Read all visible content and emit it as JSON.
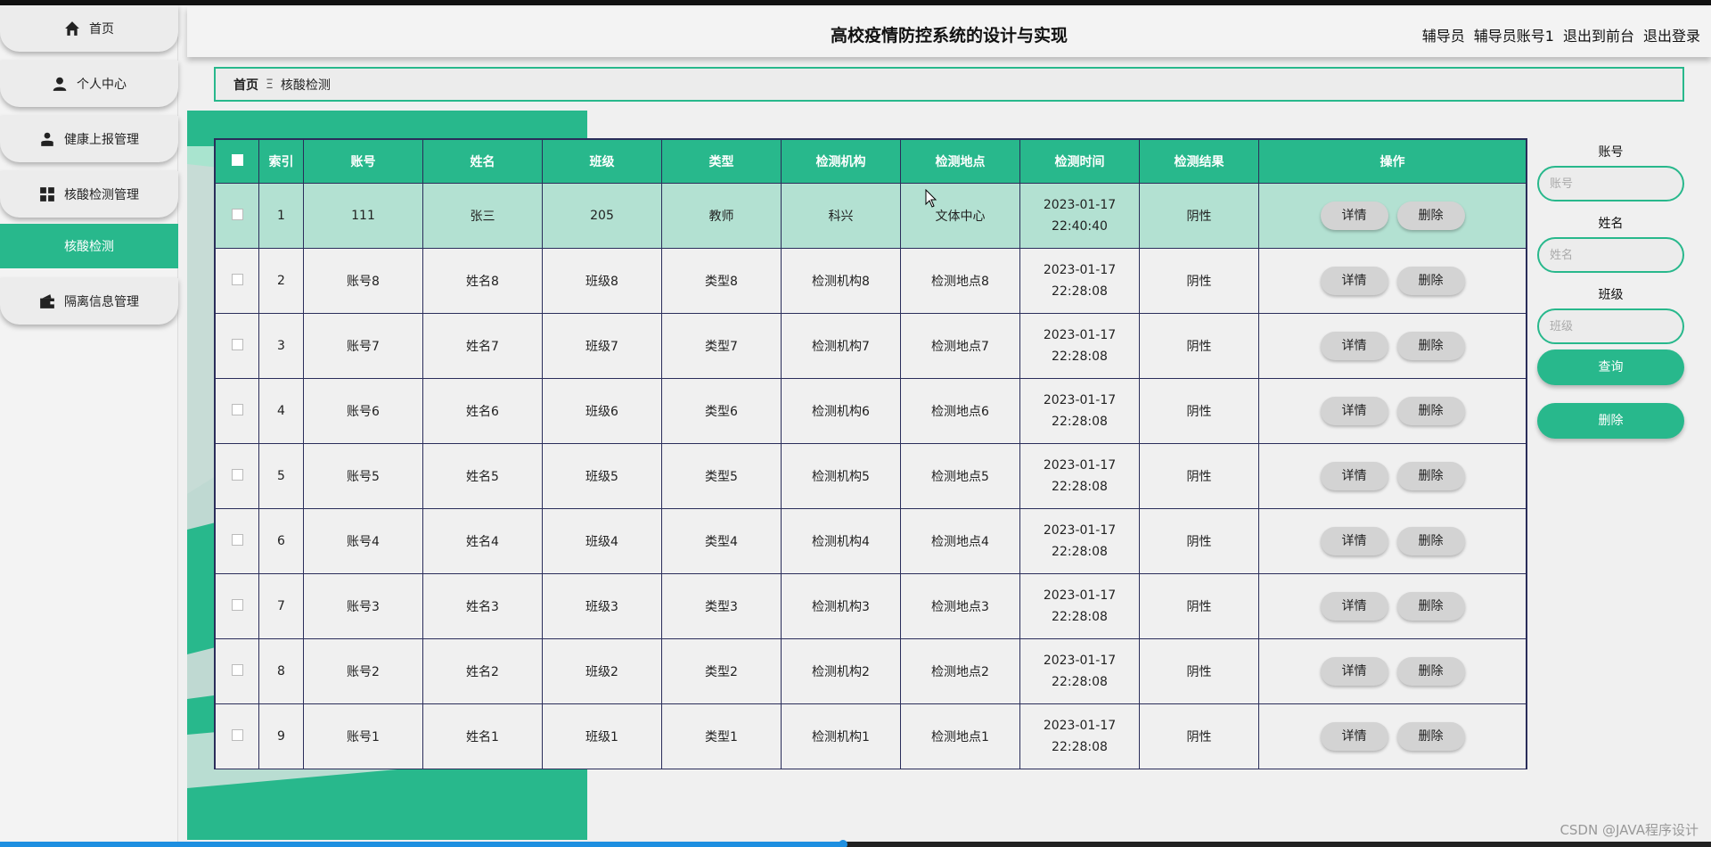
{
  "app": {
    "title": "高校疫情防控系统的设计与实现"
  },
  "header": {
    "role": "辅导员",
    "account": "辅导员账号1",
    "to_front": "退出到前台",
    "logout": "退出登录"
  },
  "sidebar": {
    "items": [
      {
        "label": "首页",
        "icon": "home-icon"
      },
      {
        "label": "个人中心",
        "icon": "person-icon"
      },
      {
        "label": "健康上报管理",
        "icon": "user-report-icon"
      },
      {
        "label": "核酸检测管理",
        "icon": "grid-icon"
      },
      {
        "label": "核酸检测",
        "icon": "",
        "active": true
      },
      {
        "label": "隔离信息管理",
        "icon": "wallet-icon"
      }
    ]
  },
  "breadcrumb": {
    "home": "首页",
    "separator": "Ξ",
    "current": "核酸检测"
  },
  "table": {
    "headers": [
      "索引",
      "账号",
      "姓名",
      "班级",
      "类型",
      "检测机构",
      "检测地点",
      "检测时间",
      "检测结果",
      "操作"
    ],
    "detail_label": "详情",
    "delete_label": "删除",
    "rows": [
      {
        "index": "1",
        "account": "111",
        "name": "张三",
        "class": "205",
        "type": "教师",
        "org": "科兴",
        "place": "文体中心",
        "time": "2023-01-17 22:40:40",
        "result": "阴性",
        "selected": true
      },
      {
        "index": "2",
        "account": "账号8",
        "name": "姓名8",
        "class": "班级8",
        "type": "类型8",
        "org": "检测机构8",
        "place": "检测地点8",
        "time": "2023-01-17 22:28:08",
        "result": "阴性"
      },
      {
        "index": "3",
        "account": "账号7",
        "name": "姓名7",
        "class": "班级7",
        "type": "类型7",
        "org": "检测机构7",
        "place": "检测地点7",
        "time": "2023-01-17 22:28:08",
        "result": "阴性"
      },
      {
        "index": "4",
        "account": "账号6",
        "name": "姓名6",
        "class": "班级6",
        "type": "类型6",
        "org": "检测机构6",
        "place": "检测地点6",
        "time": "2023-01-17 22:28:08",
        "result": "阴性"
      },
      {
        "index": "5",
        "account": "账号5",
        "name": "姓名5",
        "class": "班级5",
        "type": "类型5",
        "org": "检测机构5",
        "place": "检测地点5",
        "time": "2023-01-17 22:28:08",
        "result": "阴性"
      },
      {
        "index": "6",
        "account": "账号4",
        "name": "姓名4",
        "class": "班级4",
        "type": "类型4",
        "org": "检测机构4",
        "place": "检测地点4",
        "time": "2023-01-17 22:28:08",
        "result": "阴性"
      },
      {
        "index": "7",
        "account": "账号3",
        "name": "姓名3",
        "class": "班级3",
        "type": "类型3",
        "org": "检测机构3",
        "place": "检测地点3",
        "time": "2023-01-17 22:28:08",
        "result": "阴性"
      },
      {
        "index": "8",
        "account": "账号2",
        "name": "姓名2",
        "class": "班级2",
        "type": "类型2",
        "org": "检测机构2",
        "place": "检测地点2",
        "time": "2023-01-17 22:28:08",
        "result": "阴性"
      },
      {
        "index": "9",
        "account": "账号1",
        "name": "姓名1",
        "class": "班级1",
        "type": "类型1",
        "org": "检测机构1",
        "place": "检测地点1",
        "time": "2023-01-17 22:28:08",
        "result": "阴性"
      }
    ]
  },
  "search": {
    "account_label": "账号",
    "account_placeholder": "账号",
    "name_label": "姓名",
    "name_placeholder": "姓名",
    "class_label": "班级",
    "class_placeholder": "班级",
    "query_label": "查询",
    "delete_label": "删除"
  },
  "watermark": "CSDN @JAVA程序设计",
  "colors": {
    "accent": "#28b88c",
    "selected_row": "#b3e1d2",
    "table_border": "#2a2d5a"
  }
}
